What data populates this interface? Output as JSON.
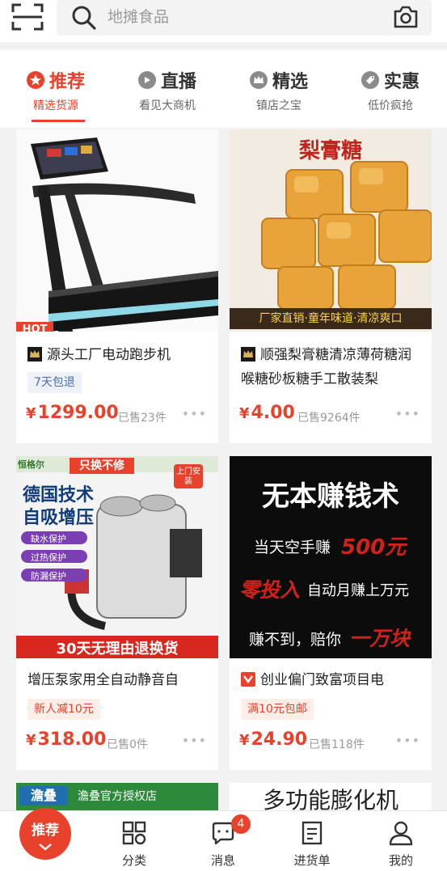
{
  "search": {
    "placeholder": "地摊食品"
  },
  "tabs": [
    {
      "title": "推荐",
      "sub": "精选货源",
      "active": true
    },
    {
      "title": "直播",
      "sub": "看见大商机",
      "active": false
    },
    {
      "title": "精选",
      "sub": "镇店之宝",
      "active": false
    },
    {
      "title": "实惠",
      "sub": "低价疯抢",
      "active": false
    }
  ],
  "products": [
    {
      "name": "源头工厂电动跑步机",
      "badge_text": "HOT",
      "tag": "7天包退",
      "price": "1299.00",
      "currency": "¥",
      "sold": "已售23件"
    },
    {
      "name": "顺强梨膏糖清凉薄荷糖润喉糖砂板糖手工散装梨",
      "image_title": "梨膏糖",
      "image_banner": "厂家直销·童年味道·清凉爽口",
      "price": "4.00",
      "currency": "¥",
      "sold": "已售9264件"
    },
    {
      "name": "增压泵家用全自动静音自",
      "brand": "恒格尔",
      "image_lines": [
        "只换不修",
        "德国技术",
        "自吸增压",
        "缺水保护",
        "过热保护",
        "防漏保护",
        "30天无理由退换货",
        "上门安装"
      ],
      "tag": "新人减10元",
      "price": "318.00",
      "currency": "¥",
      "sold": "已售0件"
    },
    {
      "name": "创业偏门致富项目电",
      "image_lines": [
        "无本赚钱术",
        "当天空手赚",
        "500元",
        "零投入",
        "自动月赚上万元",
        "赚不到，赔你",
        "一万块"
      ],
      "tag": "满10元包邮",
      "price": "24.90",
      "currency": "¥",
      "sold": "已售118件"
    }
  ],
  "peek": [
    {
      "image_text": "澹叠",
      "shop": "澹叠官方授权店"
    },
    {
      "image_text": "多功能膨化机"
    }
  ],
  "bottom_nav": [
    {
      "label": "推荐",
      "active": true
    },
    {
      "label": "分类"
    },
    {
      "label": "消息",
      "badge": "4"
    },
    {
      "label": "进货单"
    },
    {
      "label": "我的"
    }
  ],
  "colors": {
    "accent": "#e8412c",
    "tag_blue": "#4a6fa5"
  }
}
